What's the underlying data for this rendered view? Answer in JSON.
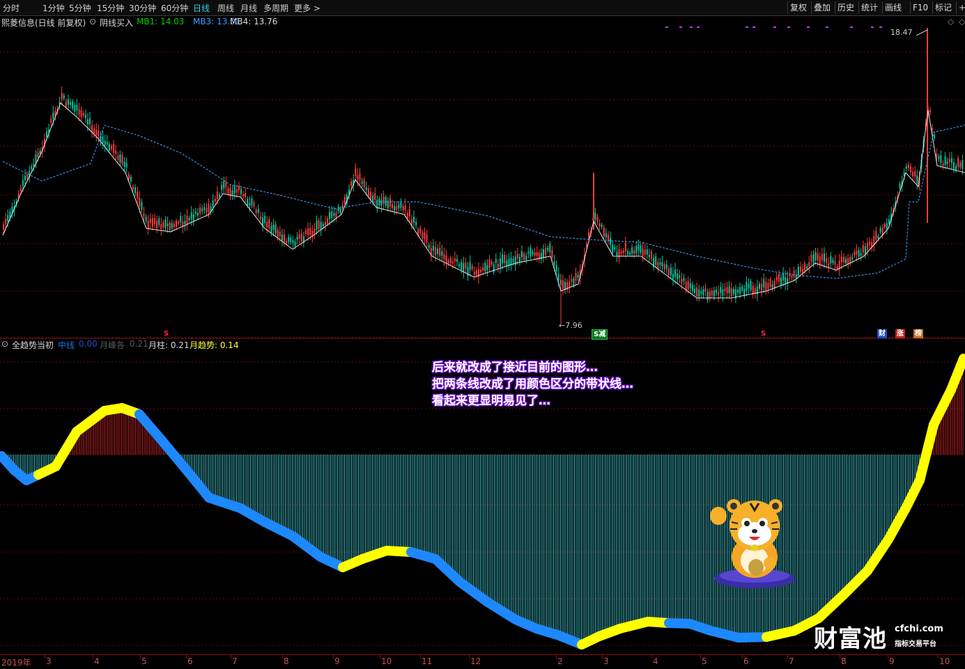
{
  "toolbar": {
    "periods": [
      "分时",
      "1分钟",
      "5分钟",
      "15分钟",
      "30分钟",
      "60分钟",
      "日线",
      "周线",
      "月线",
      "多周期",
      "更多 >"
    ],
    "active_period": "日线",
    "tools": [
      "复权",
      "叠加",
      "历史",
      "统计",
      "画线",
      "F10",
      "标记",
      "+"
    ]
  },
  "main_chart": {
    "stock_name": "熙菱信息(日线 前复权)",
    "indicator_name": "阴线买入",
    "mb1": "MB1: 14.03",
    "mb3": "MB3: 13.01",
    "mb4": "MB4: 13.76",
    "high_label": "18.47",
    "low_label": "7.96",
    "markers": [
      "S",
      "S",
      "S",
      "财",
      "涨",
      "榜"
    ],
    "marker_badge": "减",
    "colors": {
      "up": "#ff3c3c",
      "down": "#00c8a0",
      "ma_short": "#e6e6e6",
      "ma_long": "#3a8fe0",
      "mb1": "#00d000",
      "mb3": "#3aa0ff"
    }
  },
  "indicator_panel": {
    "name": "全趋势当初",
    "mid_label": "中线",
    "mid_value": "0.00",
    "peak_label": "月峰各",
    "peak_value": "0.21",
    "bar_label": "月柱: 0.21",
    "trend_label": "月趋势: 0.14",
    "colors": {
      "rising": "#ffff00",
      "falling": "#1e88ff",
      "bar_pos": "#d02828",
      "bar_neg": "#45c8d2"
    }
  },
  "annotation": {
    "lines": [
      "后来就改成了接近目前的图形…",
      "把两条线改成了用颜色区分的带状线…",
      "看起来更显明易见了…"
    ]
  },
  "time_axis": {
    "labels": [
      "2019年",
      "3",
      "4",
      "5",
      "6",
      "7",
      "8",
      "9",
      "10",
      "11",
      "12",
      "2",
      "3",
      "4",
      "5",
      "6",
      "7",
      "8",
      "9",
      "10"
    ]
  },
  "watermark": {
    "brand": "财富池",
    "site": "cfchi.com",
    "slogan": "指标交易平台"
  }
}
